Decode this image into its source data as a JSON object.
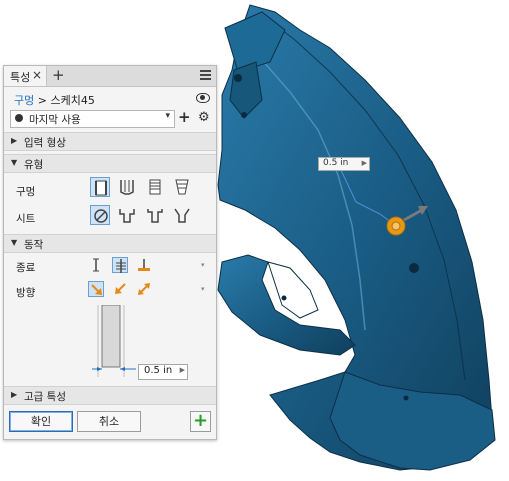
{
  "colors": {
    "model": "#1a5d85",
    "model_dark": "#0f3f5e",
    "accent": "#1f6fc5",
    "handle": "#e59a17"
  },
  "tab": {
    "label": "특성",
    "close": "×",
    "add": "+"
  },
  "breadcrumb": {
    "link": "구멍",
    "sep": ">",
    "current": "스케치45"
  },
  "preset": {
    "value": "마지막 사용"
  },
  "sections": {
    "input_geometry": "입력 형상",
    "type": "유형",
    "behavior": "동작",
    "advanced": "고급 특성"
  },
  "type_rows": {
    "hole": "구멍",
    "seat": "시트"
  },
  "behavior_rows": {
    "termination": "종료",
    "direction": "방향"
  },
  "dimension": {
    "value": "0.5 in"
  },
  "viewport_dim": {
    "value": "0.5 in"
  },
  "buttons": {
    "ok": "확인",
    "cancel": "취소",
    "apply": "+"
  },
  "icons": {
    "eye": "eye-icon",
    "settings": "gear-icon",
    "menu": "hamburger-menu-icon"
  }
}
